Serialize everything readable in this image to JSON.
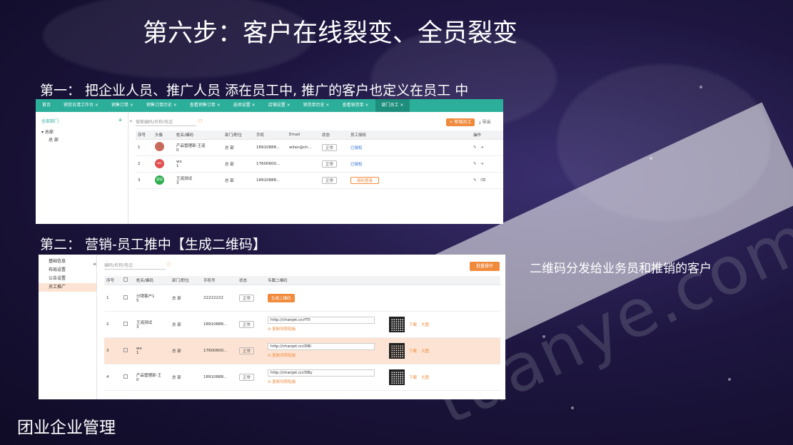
{
  "slide": {
    "title": "第六步：客户在线裂变、全员裂变",
    "step1": "第一： 把企业人员、推广人员  添在员工中,    推广的客户也定义在员工 中",
    "step2": "第二： 营销-员工推中【生成二维码】",
    "side_note": "二维码分发给业务员和推销的客户",
    "footer": "团业企业管理",
    "watermark": "tuanye.com"
  },
  "shot1": {
    "tabs": [
      "首页",
      "销货日清工作台 ×",
      "销售订单 ×",
      "销售订单历史 ×",
      "查看销售订单 ×",
      "选项设置 ×",
      "店铺设置 ×",
      "销货单历史 ×",
      "查看销货单 ×",
      "部门员工 ×"
    ],
    "sidebar": {
      "header": "全部部门",
      "dept": "总部",
      "sub": "总 部"
    },
    "search_placeholder": "搜索编码/名称/电话",
    "add_button": "+ 新增员工",
    "export": "导出",
    "columns": [
      "序号",
      "头像",
      "姓名/编码",
      "部门/职位",
      "手机",
      "Email",
      "状态",
      "员工授权",
      "操作"
    ],
    "rows": [
      {
        "no": "1",
        "avatar": "",
        "name": "产品管理部-王涟",
        "code": "0",
        "dept": "总 部",
        "phone": "18910888...",
        "email": "wlian@ch...",
        "status": "正常",
        "auth": "已授权"
      },
      {
        "no": "2",
        "avatar": "wx",
        "name": "wx",
        "code": "1",
        "dept": "总 部",
        "phone": "17600600...",
        "email": "",
        "status": "正常",
        "auth": "已授权"
      },
      {
        "no": "3",
        "avatar": "测试",
        "name": "王涟测试",
        "code": "3",
        "dept": "总 部",
        "phone": "18910888...",
        "email": "",
        "status": "正常",
        "auth": "授权登录"
      }
    ]
  },
  "shot2": {
    "sidebar": [
      "基础信息",
      "布局设置",
      "公告设置",
      "员工推广"
    ],
    "search_placeholder": "编码/名称/电话",
    "batch_button": "批量操作",
    "columns": [
      "序号",
      "",
      "姓名/编码",
      "部门/职位",
      "手机号",
      "状态",
      "专属二维码"
    ],
    "generate_label": "生成二维码",
    "copy_label": "复制到剪贴板",
    "download": "下载",
    "large": "大图",
    "rows": [
      {
        "no": "1",
        "name": "分销客户1",
        "code": "5",
        "dept": "总 部",
        "phone": "22222222",
        "status": "正常",
        "url": ""
      },
      {
        "no": "2",
        "name": "王涟测试",
        "code": "3",
        "dept": "总 部",
        "phone": "18910888...",
        "status": "正常",
        "url": "http://chanjet.cn/fTll"
      },
      {
        "no": "3",
        "name": "wx",
        "code": "1",
        "dept": "总 部",
        "phone": "17600600...",
        "status": "正常",
        "url": "http://chanjet.cn/DBl"
      },
      {
        "no": "4",
        "name": "产品管理部-王",
        "code": "0",
        "dept": "总 部",
        "phone": "18910888...",
        "status": "正常",
        "url": "http://chanjet.cn/DBy"
      }
    ]
  }
}
